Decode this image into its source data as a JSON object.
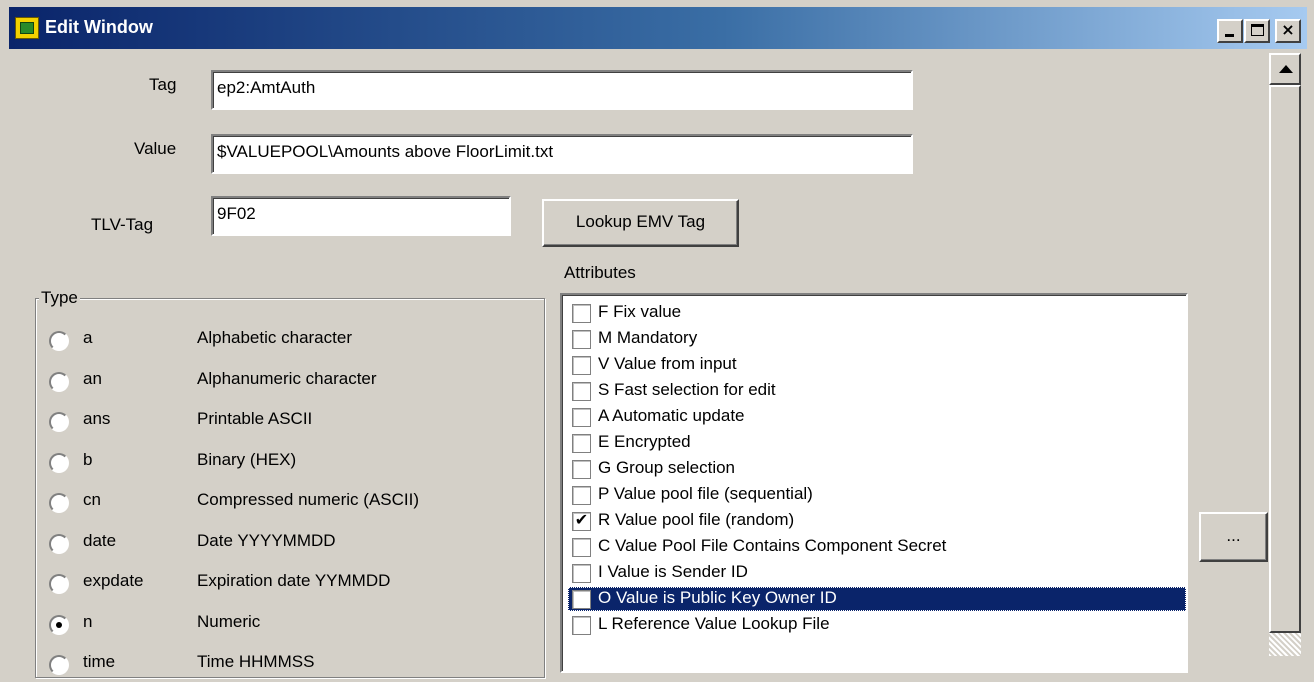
{
  "window": {
    "title": "Edit Window",
    "icon": "app-icon",
    "controls": {
      "minimize": "minimize-icon",
      "maximize": "maximize-icon",
      "close": "×"
    }
  },
  "fields": {
    "tag": {
      "label": "Tag",
      "value": "ep2:AmtAuth"
    },
    "value": {
      "label": "Value",
      "value": "$VALUEPOOL\\Amounts above FloorLimit.txt"
    },
    "tlv_tag": {
      "label": "TLV-Tag",
      "value": "9F02"
    }
  },
  "buttons": {
    "lookup_emv_tag": "Lookup EMV Tag",
    "ellipsis": "..."
  },
  "type_group": {
    "legend": "Type",
    "options": [
      {
        "code": "a",
        "description": "Alphabetic character",
        "checked": false
      },
      {
        "code": "an",
        "description": "Alphanumeric character",
        "checked": false
      },
      {
        "code": "ans",
        "description": "Printable ASCII",
        "checked": false
      },
      {
        "code": "b",
        "description": "Binary (HEX)",
        "checked": false
      },
      {
        "code": "cn",
        "description": "Compressed numeric (ASCII)",
        "checked": false
      },
      {
        "code": "date",
        "description": "Date YYYYMMDD",
        "checked": false
      },
      {
        "code": "expdate",
        "description": "Expiration date YYMMDD",
        "checked": false
      },
      {
        "code": "n",
        "description": "Numeric",
        "checked": true
      },
      {
        "code": "time",
        "description": "Time HHMMSS",
        "checked": false
      }
    ]
  },
  "attributes": {
    "label": "Attributes",
    "items": [
      {
        "label": "F  Fix value",
        "checked": false,
        "selected": false
      },
      {
        "label": "M Mandatory",
        "checked": false,
        "selected": false
      },
      {
        "label": "V  Value from input",
        "checked": false,
        "selected": false
      },
      {
        "label": "S Fast selection for edit",
        "checked": false,
        "selected": false
      },
      {
        "label": "A Automatic update",
        "checked": false,
        "selected": false
      },
      {
        "label": "E Encrypted",
        "checked": false,
        "selected": false
      },
      {
        "label": "G Group selection",
        "checked": false,
        "selected": false
      },
      {
        "label": "P Value pool file (sequential)",
        "checked": false,
        "selected": false
      },
      {
        "label": "R Value pool file (random)",
        "checked": true,
        "selected": false
      },
      {
        "label": "C Value Pool File Contains Component Secret",
        "checked": false,
        "selected": false
      },
      {
        "label": "I Value is Sender ID",
        "checked": false,
        "selected": false
      },
      {
        "label": "O Value is Public Key Owner ID",
        "checked": false,
        "selected": true
      },
      {
        "label": "L Reference Value Lookup File",
        "checked": false,
        "selected": false
      }
    ]
  },
  "colors": {
    "face": "#d4d0c8",
    "title_start": "#0a246a",
    "title_end": "#a6caf0",
    "selection": "#0a246a"
  }
}
